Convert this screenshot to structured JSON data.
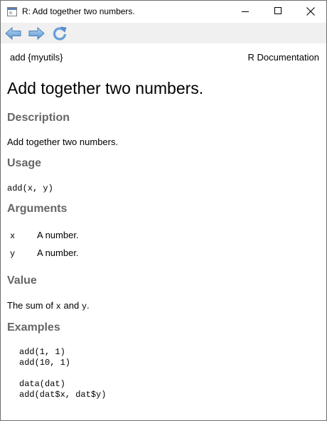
{
  "window": {
    "title": "R: Add together two numbers.",
    "icon": "r-help-window-icon",
    "controls": {
      "minimize": "minimize-icon",
      "maximize": "maximize-icon",
      "close": "close-icon"
    }
  },
  "toolbar": {
    "buttons": [
      {
        "name": "back",
        "icon": "arrow-left-icon",
        "color": "#4a8fd4"
      },
      {
        "name": "forward",
        "icon": "arrow-right-icon",
        "color": "#4a8fd4"
      },
      {
        "name": "refresh",
        "icon": "refresh-icon",
        "color": "#4a8fd4"
      }
    ]
  },
  "doc": {
    "topic": "add {myutils}",
    "header_right": "R Documentation",
    "title": "Add together two numbers.",
    "sections": {
      "description": {
        "heading": "Description",
        "text": "Add together two numbers."
      },
      "usage": {
        "heading": "Usage",
        "code": "add(x, y)"
      },
      "arguments": {
        "heading": "Arguments",
        "items": [
          {
            "name": "x",
            "desc": "A number."
          },
          {
            "name": "y",
            "desc": "A number."
          }
        ]
      },
      "value": {
        "heading": "Value",
        "text_before": "The sum of",
        "code_x": "x",
        "text_mid": "and",
        "code_y": "y",
        "text_after": "."
      },
      "examples": {
        "heading": "Examples",
        "lines": [
          "add(1, 1)",
          "add(10, 1)",
          "",
          "data(dat)",
          "add(dat$x, dat$y)"
        ]
      }
    },
    "heading_color": "#666666"
  }
}
